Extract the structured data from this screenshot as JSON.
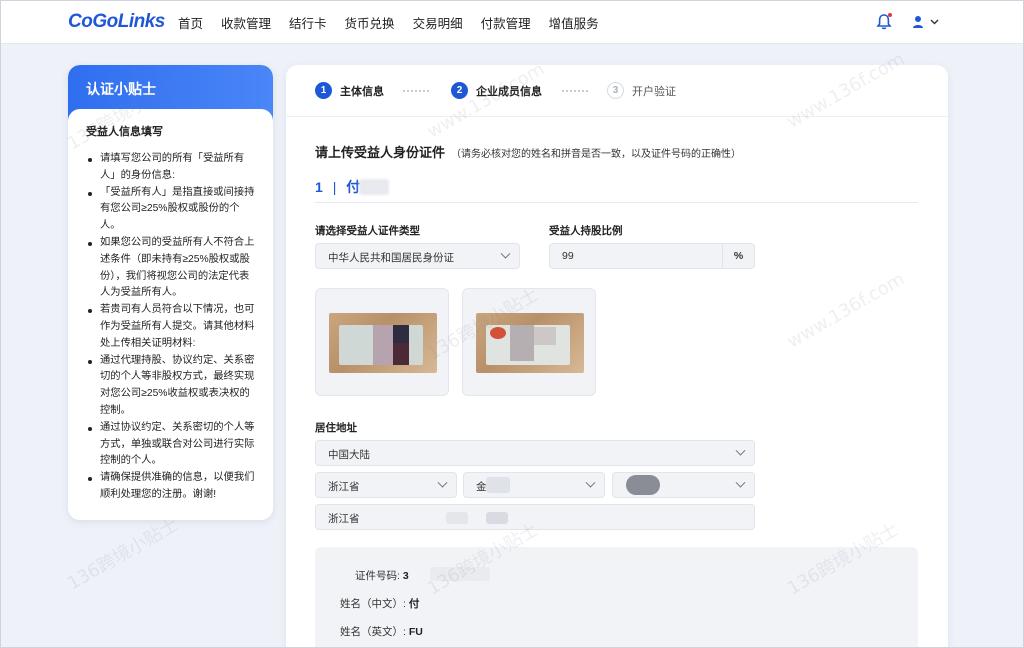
{
  "header": {
    "logo": "CoGoLinks",
    "nav": [
      "首页",
      "收款管理",
      "结行卡",
      "货币兑换",
      "交易明细",
      "付款管理",
      "增值服务"
    ],
    "accent": "#1f58d6"
  },
  "tips": {
    "title": "认证小贴士",
    "subtitle": "受益人信息填写",
    "items": [
      "请填写您公司的所有「受益所有人」的身份信息:",
      "「受益所有人」是指直接或间接持有您公司≥25%股权或股份的个人。",
      "如果您公司的受益所有人不符合上述条件（即未持有≥25%股权或股份），我们将视您公司的法定代表人为受益所有人。",
      "若贵司有人员符合以下情况，也可作为受益所有人提交。请其他材料处上传相关证明材料:",
      "通过代理持股、协议约定、关系密切的个人等非股权方式，最终实现对您公司≥25%收益权或表决权的控制。",
      "通过协议约定、关系密切的个人等方式，单独或联合对公司进行实际控制的个人。",
      "请确保提供准确的信息，以便我们顺利处理您的注册。谢谢!"
    ]
  },
  "steps": [
    {
      "num": "1",
      "label": "主体信息"
    },
    {
      "num": "2",
      "label": "企业成员信息"
    },
    {
      "num": "3",
      "label": "开户验证"
    }
  ],
  "form": {
    "title": "请上传受益人身份证件",
    "note": "（请务必核对您的姓名和拼音是否一致，以及证件号码的正确性）",
    "person_index": "1",
    "person_name": "付",
    "id_type_label": "请选择受益人证件类型",
    "id_type_value": "中华人民共和国居民身份证",
    "ratio_label": "受益人持股比例",
    "ratio_value": "99",
    "ratio_unit": "%",
    "address_label": "居住地址",
    "country": "中国大陆",
    "province": "浙江省",
    "city": "金",
    "address_line": "浙江省"
  },
  "info": {
    "id_label": "证件号码:",
    "id_value": "3",
    "name_cn_label": "姓名（中文）:",
    "name_cn_value": "付",
    "name_en_label": "姓名（英文）:",
    "name_en_value": "FU"
  },
  "watermark": [
    "136跨境小贴士",
    "www.136f.com"
  ]
}
